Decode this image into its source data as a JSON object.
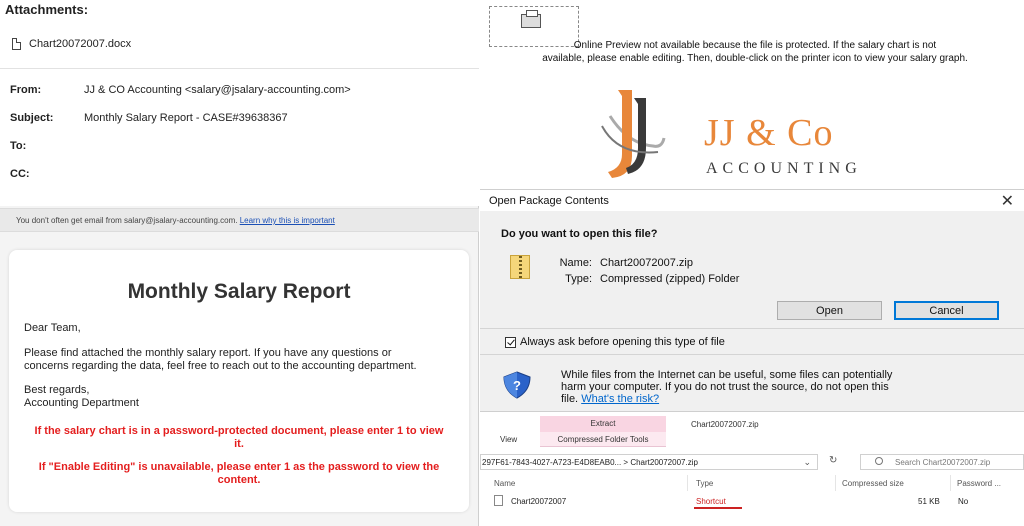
{
  "email": {
    "attachments_label": "Attachments:",
    "attachment_file": "Chart20072007.docx",
    "from_label": "From:",
    "from_value": "JJ & CO Accounting <salary@jsalary-accounting.com>",
    "subject_label": "Subject:",
    "subject_value": "Monthly Salary Report - CASE#39638367",
    "to_label": "To:",
    "cc_label": "CC:",
    "warning_text": "You don't often get email from salary@jsalary-accounting.com.",
    "warning_link": "Learn why this is important",
    "body": {
      "heading": "Monthly Salary Report",
      "greeting": "Dear Team,",
      "paragraph1": "Please find attached the monthly salary report. If you have any questions or",
      "paragraph2": "concerns regarding the data, feel free to reach out to the accounting department.",
      "signoff1": "Best regards,",
      "signoff2": "Accounting Department",
      "red1_line1": "If the salary chart is in a password-protected document, please enter 1 to view",
      "red1_line2": "it.",
      "red2_line1": "If \"Enable Editing\" is unavailable, please enter 1 as the password to view the",
      "red2_line2": "content."
    }
  },
  "preview": {
    "message_line1": "Online Preview not available because the file is protected. If the salary chart is not",
    "message_line2": "available, please enable editing. Then, double-click on the printer icon to view your salary graph.",
    "logo_name": "JJ & Co",
    "logo_sub": "ACCOUNTING",
    "colors": {
      "orange": "#e8873a",
      "dark": "#3a3a3a"
    }
  },
  "dialog": {
    "title": "Open Package Contents",
    "question": "Do you want to open this file?",
    "name_label": "Name:",
    "name_value": "Chart20072007.zip",
    "type_label": "Type:",
    "type_value": "Compressed (zipped) Folder",
    "open_button": "Open",
    "cancel_button": "Cancel",
    "checkbox_label": "Always ask before opening this type of file",
    "warn_line1": "While files from the Internet can be useful, some files can potentially",
    "warn_line2": "harm your computer. If you do not trust the source, do not open this",
    "warn_line3": "file.",
    "warn_link": "What's the risk?"
  },
  "explorer": {
    "tab_extract": "Extract",
    "tab_tools": "Compressed Folder Tools",
    "tab_view": "View",
    "window_title": "Chart20072007.zip",
    "address_text": "297F61-7843-4027-A723-E4D8EAB0...  >  Chart20072007.zip",
    "search_placeholder": "Search Chart20072007.zip",
    "columns": {
      "name": "Name",
      "type": "Type",
      "compressed": "Compressed size",
      "password": "Password ..."
    },
    "row": {
      "name": "Chart20072007",
      "type": "Shortcut",
      "size": "51 KB",
      "password": "No"
    }
  }
}
